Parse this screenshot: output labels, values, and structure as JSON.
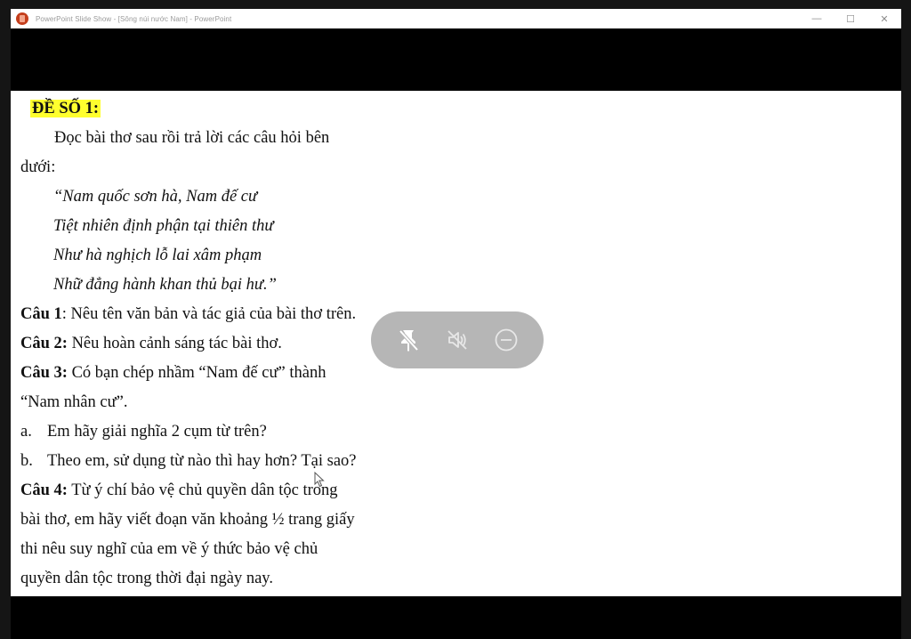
{
  "window": {
    "title": "PowerPoint Slide Show - [Sông núi nước Nam] - PowerPoint",
    "controls": {
      "minimize": "—",
      "maximize": "☐",
      "close": "✕"
    }
  },
  "slide": {
    "heading": "ĐỀ SỐ 1:",
    "intro_1": "Đọc bài thơ sau rồi trả lời các câu hỏi bên",
    "intro_2": "dưới:",
    "poem": [
      "“Nam quốc sơn hà, Nam đế cư",
      "Tiệt nhiên định phận tại thiên thư",
      "Như hà nghịch lỗ lai xâm phạm",
      "Nhữ đẳng hành khan thủ bại hư.”"
    ],
    "q1_label": "Câu 1",
    "q1_text": ": Nêu tên văn bản và tác giả của bài thơ trên.",
    "q2_label": "Câu 2:",
    "q2_text": " Nêu hoàn cảnh sáng tác bài thơ.",
    "q3_label": "Câu 3:",
    "q3_text": " Có bạn chép nhầm “Nam đế cư” thành",
    "q3_text_2": "“Nam nhân cư”.",
    "sub_a_marker": "a.",
    "sub_a_text": "Em hãy giải nghĩa 2 cụm từ trên?",
    "sub_b_marker": "b.",
    "sub_b_text": "Theo em, sử dụng từ nào thì hay hơn? Tại sao?",
    "q4_label": "Câu 4:",
    "q4_text": " Từ ý chí bảo vệ chủ quyền dân tộc trong",
    "q4_lines": [
      "bài thơ, em hãy viết đoạn văn khoảng ½ trang giấy",
      "thi nêu suy nghĩ của em về ý thức bảo vệ chủ",
      "quyền dân tộc trong thời đại ngày nay."
    ]
  },
  "toolbar": {
    "icons": [
      "unpin-icon",
      "mute-icon",
      "minimize-circle-icon"
    ],
    "color": "#b3b3b3"
  },
  "colors": {
    "highlight": "#ffff2e",
    "app_icon": "#c43e1c"
  }
}
